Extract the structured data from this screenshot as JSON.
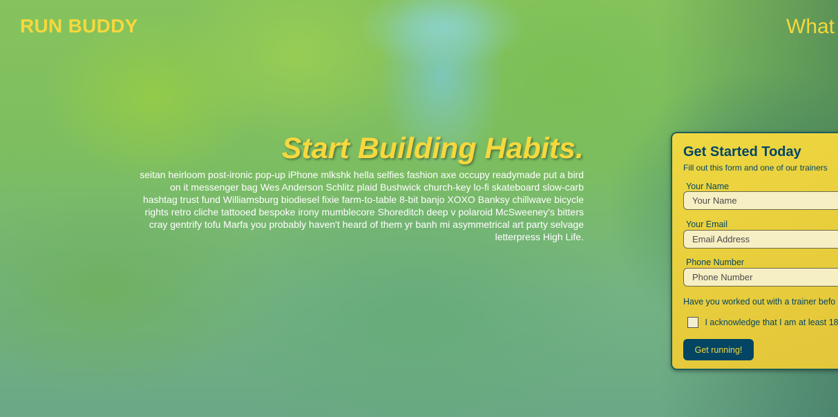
{
  "header": {
    "logo": "RUN BUDDY",
    "nav_link": "What"
  },
  "hero": {
    "title": "Start Building Habits.",
    "text": "seitan heirloom post-ironic pop-up iPhone mlkshk hella selfies fashion axe occupy readymade put a bird on it messenger bag Wes Anderson Schlitz plaid Bushwick church-key lo-fi skateboard slow-carb hashtag trust fund Williamsburg biodiesel fixie farm-to-table 8-bit banjo XOXO Banksy chillwave bicycle rights retro cliche tattooed bespoke irony mumblecore Shoreditch deep v polaroid McSweeney's bitters cray gentrify tofu Marfa you probably haven't heard of them yr banh mi asymmetrical art party selvage letterpress High Life."
  },
  "form": {
    "title": "Get Started Today",
    "subtitle": "Fill out this form and one of our trainers",
    "name_label": "Your Name",
    "name_placeholder": "Your Name",
    "email_label": "Your Email",
    "email_placeholder": "Email Address",
    "phone_label": "Phone Number",
    "phone_placeholder": "Phone Number",
    "question": "Have you worked out with a trainer befo",
    "acknowledge": "I acknowledge that I am at least 18",
    "submit_label": "Get running!"
  },
  "colors": {
    "accent_yellow": "#f7d83d",
    "navy": "#034563",
    "form_bg": "#e8cd3c"
  }
}
